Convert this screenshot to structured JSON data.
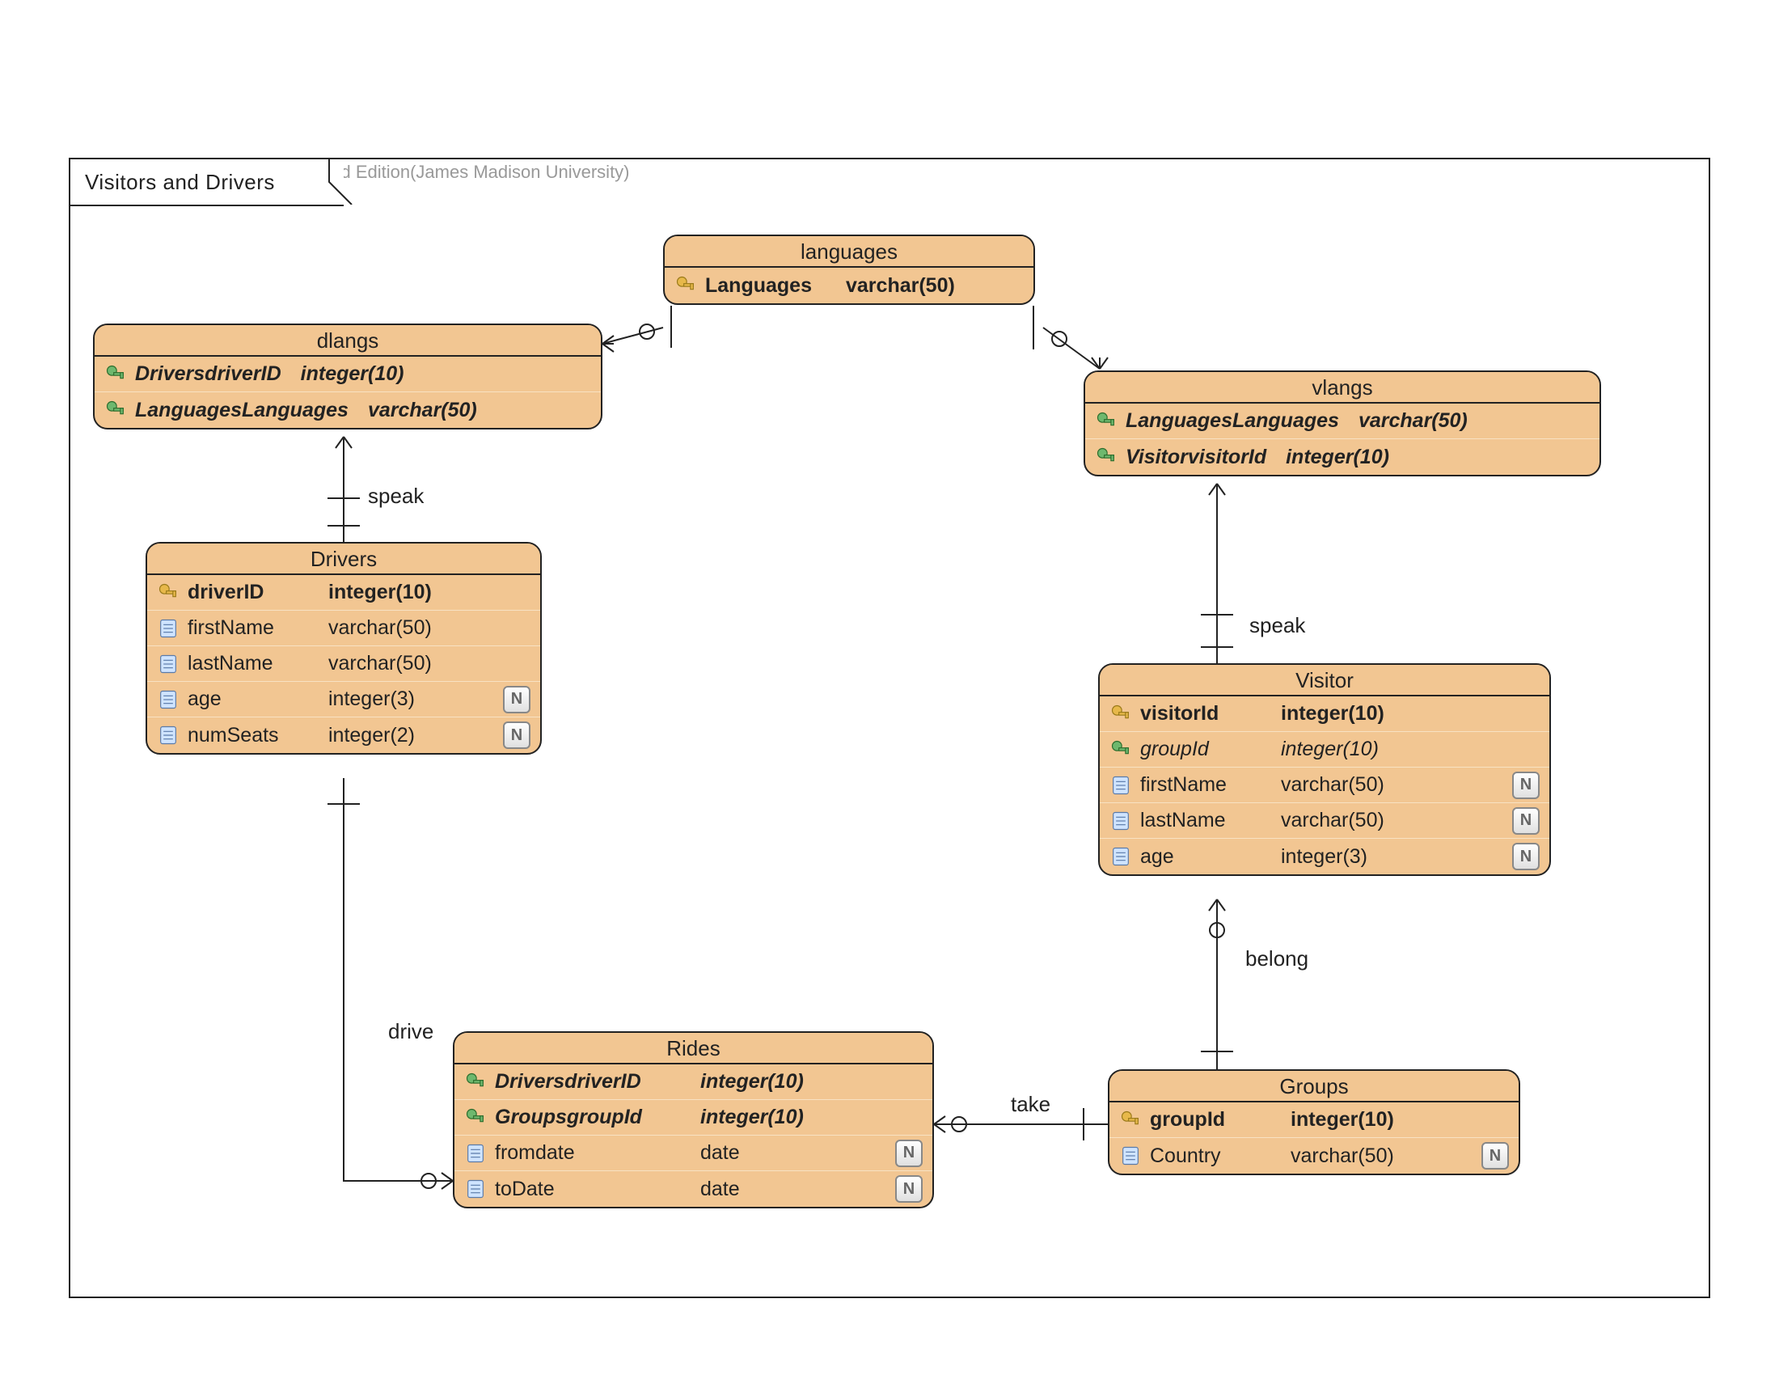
{
  "watermark": "Visual Paradigm for UML Standard Edition(James Madison University)",
  "frame": {
    "title": "Visitors and Drivers"
  },
  "entities": {
    "languages": {
      "title": "languages",
      "rows": [
        {
          "icon": "pk",
          "name": "Languages",
          "type": "varchar(50)",
          "bold": true
        }
      ]
    },
    "dlangs": {
      "title": "dlangs",
      "rows": [
        {
          "icon": "fk",
          "name": "DriversdriverID",
          "type": "integer(10)",
          "bold": true,
          "italic": true
        },
        {
          "icon": "fk",
          "name": "LanguagesLanguages",
          "type": "varchar(50)",
          "bold": true,
          "italic": true
        }
      ]
    },
    "vlangs": {
      "title": "vlangs",
      "rows": [
        {
          "icon": "fk",
          "name": "LanguagesLanguages",
          "type": "varchar(50)",
          "bold": true,
          "italic": true
        },
        {
          "icon": "fk",
          "name": "VisitorvisitorId",
          "type": "integer(10)",
          "bold": true,
          "italic": true
        }
      ]
    },
    "drivers": {
      "title": "Drivers",
      "rows": [
        {
          "icon": "pk",
          "name": "driverID",
          "type": "integer(10)",
          "bold": true
        },
        {
          "icon": "col",
          "name": "firstName",
          "type": "varchar(50)"
        },
        {
          "icon": "col",
          "name": "lastName",
          "type": "varchar(50)"
        },
        {
          "icon": "col",
          "name": "age",
          "type": "integer(3)",
          "nullable": true
        },
        {
          "icon": "col",
          "name": "numSeats",
          "type": "integer(2)",
          "nullable": true
        }
      ]
    },
    "visitor": {
      "title": "Visitor",
      "rows": [
        {
          "icon": "pk",
          "name": "visitorId",
          "type": "integer(10)",
          "bold": true
        },
        {
          "icon": "fk",
          "name": "groupId",
          "type": "integer(10)",
          "italic": true
        },
        {
          "icon": "col",
          "name": "firstName",
          "type": "varchar(50)",
          "nullable": true
        },
        {
          "icon": "col",
          "name": "lastName",
          "type": "varchar(50)",
          "nullable": true
        },
        {
          "icon": "col",
          "name": "age",
          "type": "integer(3)",
          "nullable": true
        }
      ]
    },
    "rides": {
      "title": "Rides",
      "rows": [
        {
          "icon": "fk",
          "name": "DriversdriverID",
          "type": "integer(10)",
          "bold": true,
          "italic": true
        },
        {
          "icon": "fk",
          "name": "GroupsgroupId",
          "type": "integer(10)",
          "bold": true,
          "italic": true
        },
        {
          "icon": "col",
          "name": "fromdate",
          "type": "date",
          "nullable": true
        },
        {
          "icon": "col",
          "name": "toDate",
          "type": "date",
          "nullable": true
        }
      ]
    },
    "groups": {
      "title": "Groups",
      "rows": [
        {
          "icon": "pk",
          "name": "groupId",
          "type": "integer(10)",
          "bold": true
        },
        {
          "icon": "col",
          "name": "Country",
          "type": "varchar(50)",
          "nullable": true
        }
      ]
    }
  },
  "relationships": {
    "speak1": "speak",
    "speak2": "speak",
    "drive": "drive",
    "take": "take",
    "belong": "belong"
  },
  "chart_data": {
    "type": "er-diagram",
    "title": "Visitors and Drivers",
    "tool": "Visual Paradigm for UML Standard Edition (James Madison University)",
    "entities": [
      {
        "name": "languages",
        "columns": [
          {
            "name": "Languages",
            "type": "varchar(50)",
            "pk": true
          }
        ]
      },
      {
        "name": "dlangs",
        "columns": [
          {
            "name": "DriversdriverID",
            "type": "integer(10)",
            "fk": true,
            "pk": true
          },
          {
            "name": "LanguagesLanguages",
            "type": "varchar(50)",
            "fk": true,
            "pk": true
          }
        ]
      },
      {
        "name": "vlangs",
        "columns": [
          {
            "name": "LanguagesLanguages",
            "type": "varchar(50)",
            "fk": true,
            "pk": true
          },
          {
            "name": "VisitorvisitorId",
            "type": "integer(10)",
            "fk": true,
            "pk": true
          }
        ]
      },
      {
        "name": "Drivers",
        "columns": [
          {
            "name": "driverID",
            "type": "integer(10)",
            "pk": true
          },
          {
            "name": "firstName",
            "type": "varchar(50)"
          },
          {
            "name": "lastName",
            "type": "varchar(50)"
          },
          {
            "name": "age",
            "type": "integer(3)",
            "nullable": true
          },
          {
            "name": "numSeats",
            "type": "integer(2)",
            "nullable": true
          }
        ]
      },
      {
        "name": "Visitor",
        "columns": [
          {
            "name": "visitorId",
            "type": "integer(10)",
            "pk": true
          },
          {
            "name": "groupId",
            "type": "integer(10)",
            "fk": true
          },
          {
            "name": "firstName",
            "type": "varchar(50)",
            "nullable": true
          },
          {
            "name": "lastName",
            "type": "varchar(50)",
            "nullable": true
          },
          {
            "name": "age",
            "type": "integer(3)",
            "nullable": true
          }
        ]
      },
      {
        "name": "Rides",
        "columns": [
          {
            "name": "DriversdriverID",
            "type": "integer(10)",
            "fk": true,
            "pk": true
          },
          {
            "name": "GroupsgroupId",
            "type": "integer(10)",
            "fk": true,
            "pk": true
          },
          {
            "name": "fromdate",
            "type": "date",
            "nullable": true
          },
          {
            "name": "toDate",
            "type": "date",
            "nullable": true
          }
        ]
      },
      {
        "name": "Groups",
        "columns": [
          {
            "name": "groupId",
            "type": "integer(10)",
            "pk": true
          },
          {
            "name": "Country",
            "type": "varchar(50)",
            "nullable": true
          }
        ]
      }
    ],
    "relationships": [
      {
        "from": "dlangs",
        "to": "languages",
        "label": "",
        "cardinality": "many-to-one"
      },
      {
        "from": "vlangs",
        "to": "languages",
        "label": "",
        "cardinality": "many-to-one"
      },
      {
        "from": "dlangs",
        "to": "Drivers",
        "label": "speak",
        "cardinality": "many-to-one"
      },
      {
        "from": "vlangs",
        "to": "Visitor",
        "label": "speak",
        "cardinality": "many-to-one"
      },
      {
        "from": "Rides",
        "to": "Drivers",
        "label": "drive",
        "cardinality": "many-to-one"
      },
      {
        "from": "Rides",
        "to": "Groups",
        "label": "take",
        "cardinality": "many-to-one"
      },
      {
        "from": "Visitor",
        "to": "Groups",
        "label": "belong",
        "cardinality": "many-to-one"
      }
    ]
  }
}
